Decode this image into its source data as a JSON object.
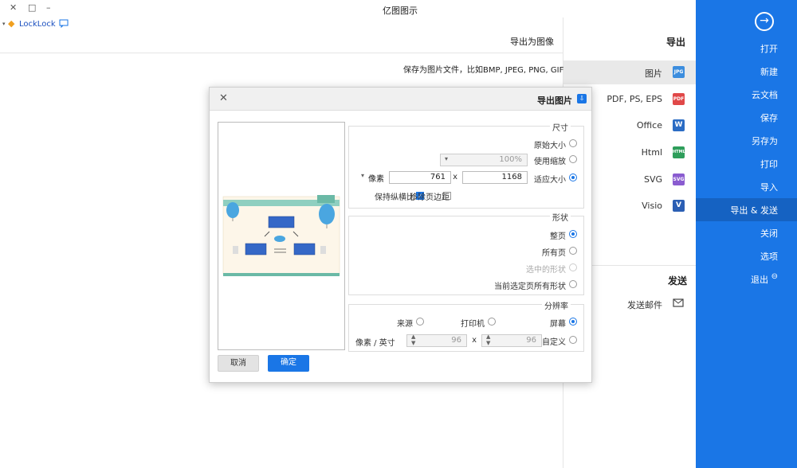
{
  "window": {
    "title": "亿图图示",
    "controls": {
      "minimize": "–",
      "maximize": "□",
      "close": "✕"
    }
  },
  "user": {
    "name": "LockLock",
    "badge_icon": "vip-diamond-icon",
    "chat_icon": "message-icon"
  },
  "page": {
    "title": "导出为图像",
    "description": "保存为图片文件，比如BMP, JPEG, PNG, GIF格式。"
  },
  "export_panel": {
    "heading": "导出",
    "items": [
      {
        "label": "图片",
        "icon_text": "JPG",
        "color": "#3c8dde",
        "selected": true
      },
      {
        "label": "PDF, PS, EPS",
        "icon_text": "PDF",
        "color": "#e04848",
        "selected": false
      },
      {
        "label": "Office",
        "icon_text": "W",
        "color": "#2b6cc4",
        "selected": false
      },
      {
        "label": "Html",
        "icon_text": "HTML",
        "color": "#2e9e5b",
        "selected": false
      },
      {
        "label": "SVG",
        "icon_text": "SVG",
        "color": "#8a5cd0",
        "selected": false
      },
      {
        "label": "Visio",
        "icon_text": "V",
        "color": "#2b5fb4",
        "selected": false
      }
    ],
    "send_heading": "发送",
    "send_items": [
      {
        "label": "发送邮件",
        "icon": "email-send-icon"
      }
    ]
  },
  "sidebar": {
    "back_icon": "back-arrow-icon",
    "items": [
      {
        "label": "打开",
        "selected": false
      },
      {
        "label": "新建",
        "selected": false
      },
      {
        "label": "云文档",
        "selected": false
      },
      {
        "label": "保存",
        "selected": false
      },
      {
        "label": "另存为",
        "selected": false
      },
      {
        "label": "打印",
        "selected": false
      },
      {
        "label": "导入",
        "selected": false
      },
      {
        "label": "导出 & 发送",
        "selected": true
      },
      {
        "label": "关闭",
        "selected": false
      },
      {
        "label": "选项",
        "selected": false
      },
      {
        "label": "退出",
        "selected": false,
        "icon": "exit-icon"
      }
    ]
  },
  "dialog": {
    "title": "导出图片",
    "close": "✕",
    "size_group": {
      "title": "尺寸",
      "original": "原始大小",
      "use_zoom": "使用缩放",
      "zoom_value": "100%",
      "fit_size": "适应大小",
      "width": "1168",
      "height": "761",
      "unit": "像素",
      "keep_ratio": "保持纵横比",
      "remove_margin": "移除页边距",
      "keep_ratio_checked": true,
      "remove_margin_checked": false
    },
    "range_group": {
      "title": "形状",
      "options": [
        "整页",
        "所有页",
        "选中的形状",
        "当前选定页所有形状"
      ],
      "selected_index": 0,
      "disabled_index": 2
    },
    "resolution_group": {
      "title": "分辨率",
      "options": [
        "屏幕",
        "打印机",
        "来源"
      ],
      "custom": "自定义",
      "dpi_x": "96",
      "dpi_y": "96",
      "dpi_unit": "像素 / 英寸"
    },
    "ok": "确定",
    "cancel": "取消"
  }
}
